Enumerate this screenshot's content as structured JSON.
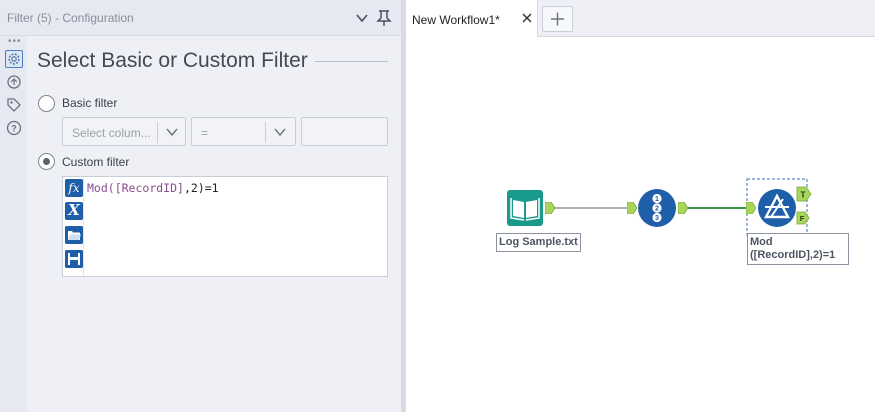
{
  "config_panel": {
    "header_title": "Filter (5) - Configuration",
    "heading": "Select Basic or Custom Filter",
    "basic_filter": {
      "label": "Basic filter",
      "selected": false,
      "column_placeholder": "Select colum...",
      "operator_value": "=",
      "value_text": ""
    },
    "custom_filter": {
      "label": "Custom filter",
      "selected": true,
      "expression": {
        "fn": "Mod(",
        "field": "[RecordID]",
        "rest": ",2)=1"
      }
    },
    "editor_buttons": [
      "fx",
      "X"
    ]
  },
  "workflow": {
    "tab_label": "New Workflow1*",
    "tools": {
      "input_label": "Log Sample.txt",
      "filter_label": "Mod ([RecordID],2)=1",
      "filter_true_anchor": "T",
      "filter_false_anchor": "F"
    }
  },
  "colors": {
    "tool_blue": "#1f5ea8",
    "input_teal": "#1a9a8c",
    "anchor_green": "#a7d65a",
    "connection": "#3b9a4a"
  }
}
